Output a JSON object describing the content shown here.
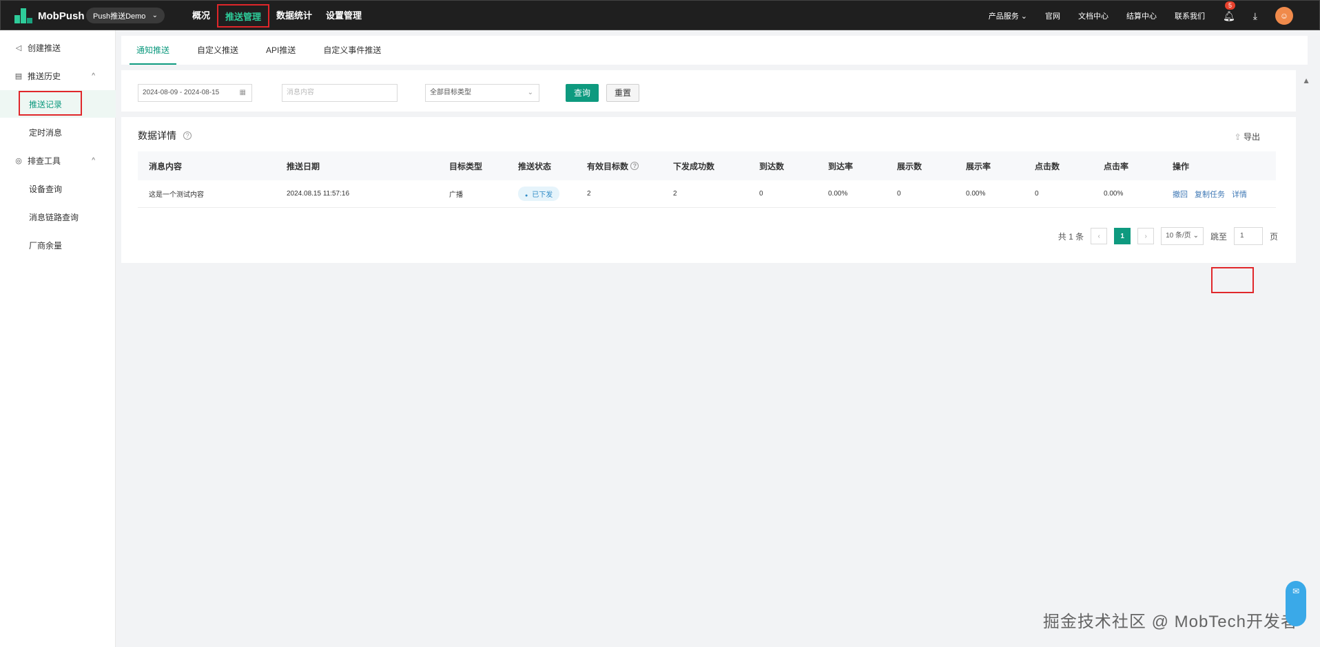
{
  "header": {
    "logo_text": "MobPush",
    "app_selector": "Push推送Demo",
    "nav": [
      "概况",
      "推送管理",
      "数据统计",
      "设置管理"
    ],
    "active_nav": "推送管理",
    "right_links": [
      "产品服务",
      "官网",
      "文档中心",
      "结算中心",
      "联系我们"
    ],
    "notification_count": "5"
  },
  "sidebar": {
    "items": [
      {
        "label": "创建推送",
        "icon": "send-icon"
      },
      {
        "label": "推送历史",
        "icon": "list-icon"
      },
      {
        "label": "推送记录"
      },
      {
        "label": "定时消息"
      },
      {
        "label": "排查工具",
        "icon": "tool-icon"
      },
      {
        "label": "设备查询"
      },
      {
        "label": "消息链路查询"
      },
      {
        "label": "厂商余量"
      }
    ]
  },
  "tabs": [
    "通知推送",
    "自定义推送",
    "API推送",
    "自定义事件推送"
  ],
  "filter": {
    "date_range": "2024-08-09 - 2024-08-15",
    "message_placeholder": "消息内容",
    "target_type": "全部目标类型",
    "query_label": "查询",
    "reset_label": "重置"
  },
  "panel": {
    "title": "数据详情",
    "export_label": "导出",
    "columns": [
      "消息内容",
      "推送日期",
      "目标类型",
      "推送状态",
      "有效目标数",
      "下发成功数",
      "到达数",
      "到达率",
      "展示数",
      "展示率",
      "点击数",
      "点击率",
      "操作"
    ],
    "rows": [
      {
        "content": "这是一个测试内容",
        "date": "2024.08.15 11:57:16",
        "target_type": "广播",
        "status": "已下发",
        "valid_targets": "2",
        "success_count": "2",
        "arrived": "0",
        "arrive_rate": "0.00%",
        "shown": "0",
        "show_rate": "0.00%",
        "clicks": "0",
        "click_rate": "0.00%",
        "actions": [
          "撤回",
          "复制任务",
          "详情"
        ]
      }
    ]
  },
  "pagination": {
    "total": "共 1 条",
    "current": "1",
    "page_size": "10 条/页",
    "jump_label": "跳至",
    "jump_value": "1",
    "page_unit": "页"
  },
  "watermark": "掘金技术社区 @ MobTech开发者"
}
